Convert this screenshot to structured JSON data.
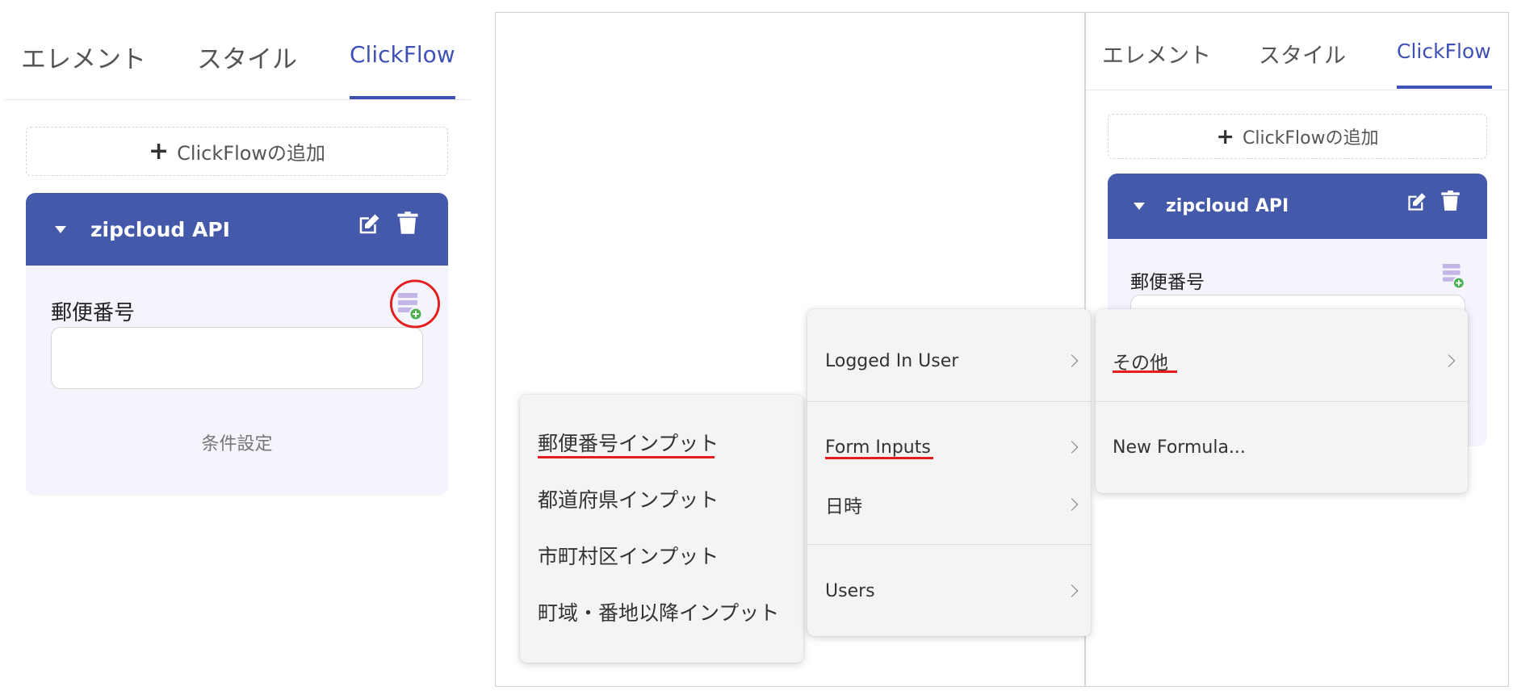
{
  "left_panel": {
    "tabs": [
      {
        "label": "エレメント"
      },
      {
        "label": "スタイル"
      },
      {
        "label": "ClickFlow",
        "active": true
      }
    ],
    "add_button_label": "ClickFlowの追加",
    "flow_card": {
      "title": "zipcloud API",
      "field_label": "郵便番号",
      "input_value": "",
      "condition_link": "条件設定"
    }
  },
  "right_panel": {
    "tabs": [
      {
        "label": "エレメント"
      },
      {
        "label": "スタイル"
      },
      {
        "label": "ClickFlow",
        "active": true
      }
    ],
    "add_button_label": "ClickFlowの追加",
    "flow_card": {
      "title": "zipcloud API",
      "field_label": "郵便番号"
    }
  },
  "menus": {
    "form_inputs_submenu": [
      "郵便番号インプット",
      "都道府県インプット",
      "市町村区インプット",
      "町域・番地以降インプット"
    ],
    "data_source_menu": [
      "Logged In User",
      "Form Inputs",
      "日時",
      "Users"
    ],
    "other_menu": [
      "その他",
      "New Formula..."
    ]
  },
  "colors": {
    "accent": "#3f51b5",
    "card_header": "#4559ab",
    "highlight_red": "#e41e1e",
    "data_icon": "#c3b6e6",
    "add_badge": "#4caf50"
  }
}
